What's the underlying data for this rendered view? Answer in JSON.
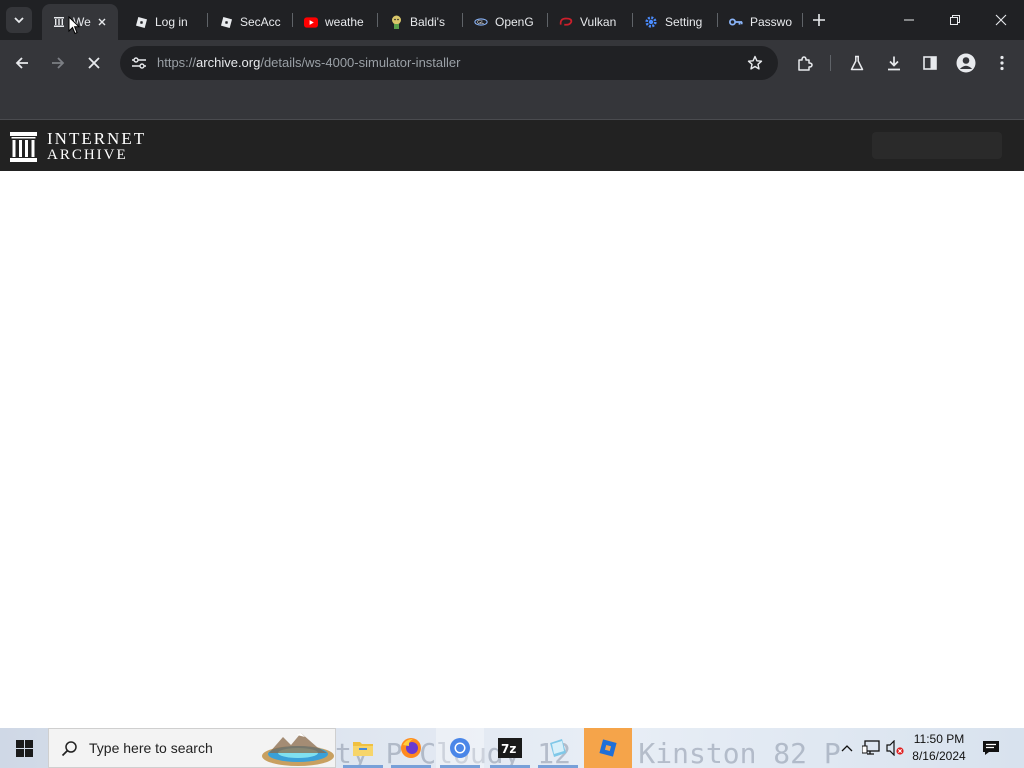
{
  "browser": {
    "tabs": [
      {
        "title": "We",
        "favicon": "internet-archive",
        "active": true
      },
      {
        "title": "Log in",
        "favicon": "roblox"
      },
      {
        "title": "SecAcc",
        "favicon": "roblox"
      },
      {
        "title": "weathe",
        "favicon": "youtube"
      },
      {
        "title": "Baldi's",
        "favicon": "baldi"
      },
      {
        "title": "OpenG",
        "favicon": "opengl"
      },
      {
        "title": "Vulkan",
        "favicon": "vulkan"
      },
      {
        "title": "Setting",
        "favicon": "settings-gear"
      },
      {
        "title": "Passwo",
        "favicon": "key"
      }
    ],
    "url": {
      "scheme": "https://",
      "host": "archive.org",
      "path": "/details/ws-4000-simulator-installer"
    },
    "loading": true
  },
  "page": {
    "logo_line1": "INTERNET",
    "logo_line2": "ARCHIVE"
  },
  "taskbar": {
    "search_placeholder": "Type here to search",
    "wallpaper_text": "ty  P Cloudy  12  72        Kinston  82 P",
    "clock_time": "11:50 PM",
    "clock_date": "8/16/2024"
  },
  "colors": {
    "chrome_dark": "#202124",
    "chrome_toolbar": "#35363a",
    "ia_header": "#222222",
    "youtube_red": "#ff0000",
    "vulkan_red": "#cc1f2b",
    "settings_blue": "#4a8cff"
  }
}
